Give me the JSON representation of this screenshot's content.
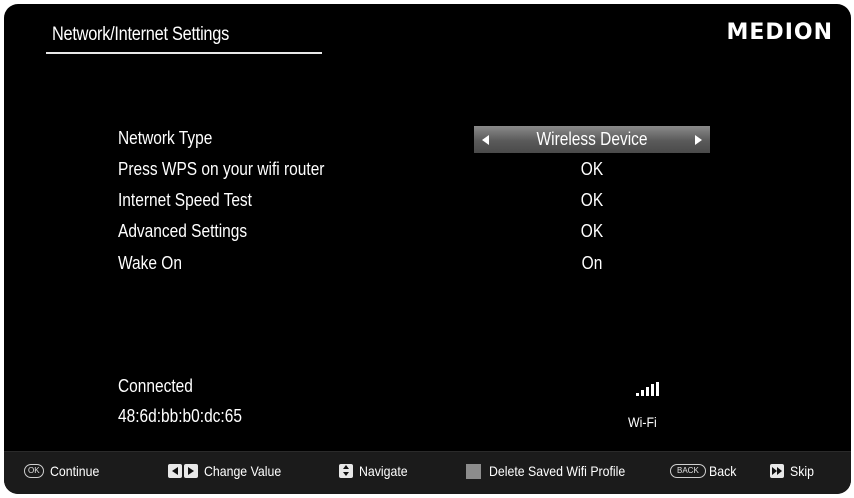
{
  "header": {
    "title": "Network/Internet Settings",
    "brand": "MEDION"
  },
  "settings": [
    {
      "label": "Network Type",
      "value": "Wireless Device",
      "selected": true
    },
    {
      "label": "Press WPS on your wifi router",
      "value": "OK"
    },
    {
      "label": "Internet Speed Test",
      "value": "OK"
    },
    {
      "label": "Advanced Settings",
      "value": "OK"
    },
    {
      "label": "Wake On",
      "value": "On"
    }
  ],
  "status": {
    "connection": "Connected",
    "mac": "48:6d:bb:b0:dc:65",
    "signal_type": "Wi-Fi",
    "signal_icon": "signal-strength-icon"
  },
  "footer": {
    "continue_key": "OK",
    "continue_label": "Continue",
    "change_value_label": "Change Value",
    "navigate_label": "Navigate",
    "delete_label": "Delete Saved Wifi Profile",
    "back_key": "BACK",
    "back_label": "Back",
    "skip_label": "Skip"
  },
  "colors": {
    "background": "#000000",
    "text": "#ffffff",
    "selector": "#6a6a6a",
    "footer": "#1b1b1b"
  }
}
